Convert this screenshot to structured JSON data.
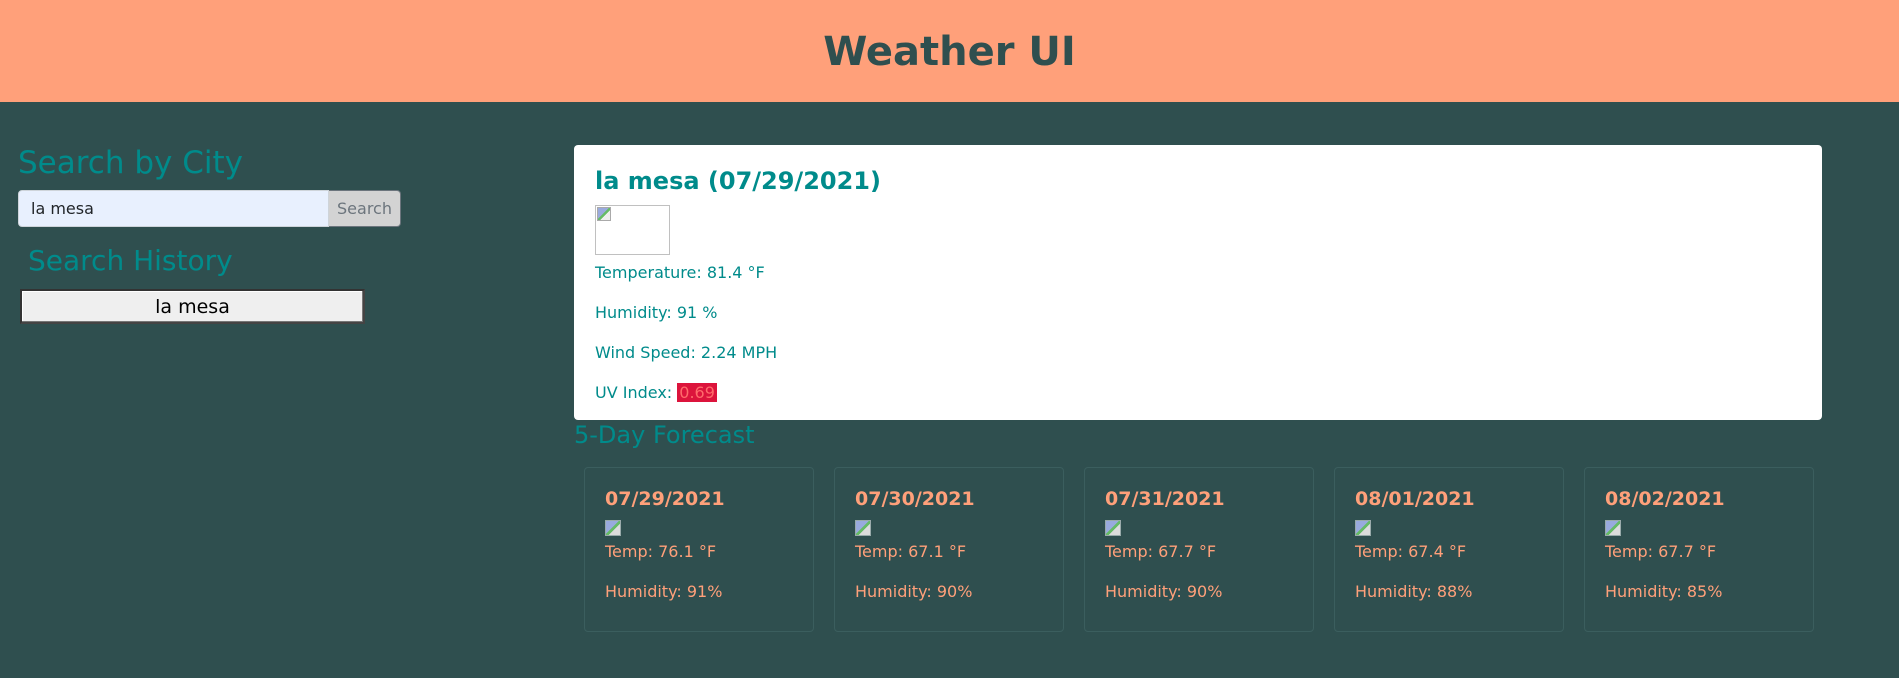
{
  "header": {
    "title": "Weather UI"
  },
  "search": {
    "title": "Search by City",
    "input_value": "la mesa",
    "button_label": "Search"
  },
  "history": {
    "title": "Search History",
    "items": [
      "la mesa"
    ]
  },
  "current": {
    "title": "la mesa (07/29/2021)",
    "temperature": "Temperature: 81.4 °F",
    "humidity": "Humidity: 91 %",
    "wind": "Wind Speed: 2.24 MPH",
    "uv_label": "UV Index: ",
    "uv_value": "0.69",
    "uv_color": "#dc143c"
  },
  "forecast": {
    "title": "5-Day Forecast",
    "days": [
      {
        "date": "07/29/2021",
        "temp": "Temp: 76.1 °F",
        "humidity": "Humidity: 91%"
      },
      {
        "date": "07/30/2021",
        "temp": "Temp: 67.1 °F",
        "humidity": "Humidity: 90%"
      },
      {
        "date": "07/31/2021",
        "temp": "Temp: 67.7 °F",
        "humidity": "Humidity: 90%"
      },
      {
        "date": "08/01/2021",
        "temp": "Temp: 67.4 °F",
        "humidity": "Humidity: 88%"
      },
      {
        "date": "08/02/2021",
        "temp": "Temp: 67.7 °F",
        "humidity": "Humidity: 85%"
      }
    ]
  },
  "colors": {
    "header_bg": "#ffa07a",
    "page_bg": "#2f4f4f",
    "accent": "#008b8b",
    "forecast_text": "#ffa07a"
  },
  "icons": {
    "current_weather": "broken-image-icon",
    "forecast_weather": "broken-image-icon"
  }
}
